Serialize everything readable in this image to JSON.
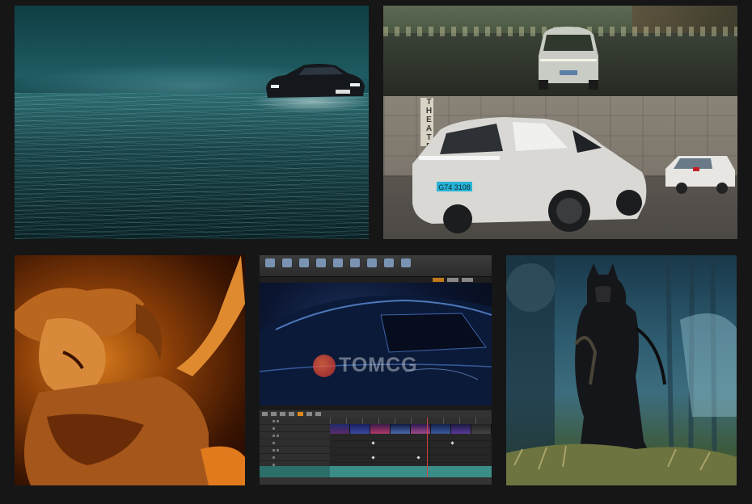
{
  "tiles": [
    {
      "id": "ocean-car"
    },
    {
      "id": "street-car"
    },
    {
      "id": "render-car",
      "sign_text": "THEATER",
      "plate_text": "G74 3108"
    },
    {
      "id": "orange-figure"
    },
    {
      "id": "editor",
      "watermark": "TOMCG"
    },
    {
      "id": "dark-knight"
    }
  ],
  "colors": {
    "background": "#161616",
    "editor_accent": "#e08a1a",
    "timeline_track": "#3b8d88"
  }
}
